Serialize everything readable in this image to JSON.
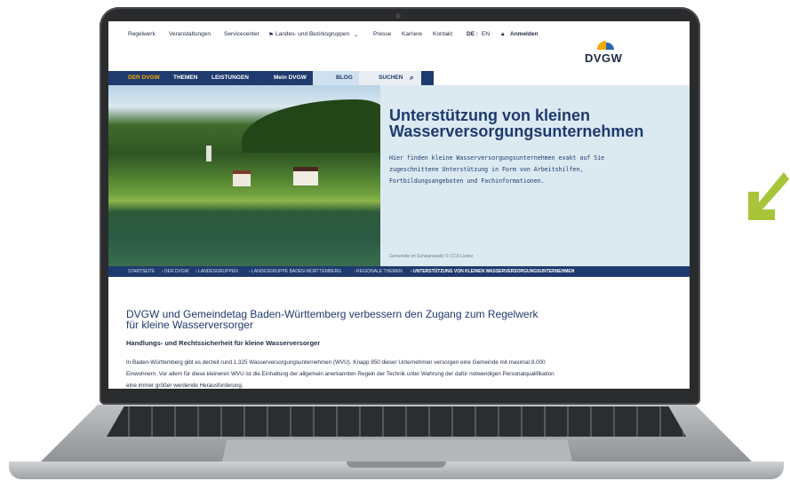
{
  "topnav": {
    "items": [
      "Regelwerk",
      "Veranstaltungen",
      "Servicecenter",
      "Landes- und Bezirksgruppen",
      "Presse",
      "Karriere",
      "Kontakt"
    ],
    "lang_de": "DE",
    "lang_sep": "|",
    "lang_en": "EN",
    "login": "Anmelden"
  },
  "logo": {
    "text": "DVGW"
  },
  "mainnav": {
    "items": [
      "DER DVGW",
      "THEMEN",
      "LEISTUNGEN",
      "Mein DVGW",
      "BLOG",
      "SUCHEN"
    ]
  },
  "hero": {
    "title_line1": "Unterstützung von kleinen",
    "title_line2": "Wasserversorgungsunternehmen",
    "text_line1": "Hier finden kleine Wasserversorgungsunternehmen exakt auf Sie",
    "text_line2": "zugeschnittene Unterstützung in Form von Arbeitshilfen,",
    "text_line3": "Fortbildungsangeboten und Fachinformationen.",
    "caption": "Gemeinde im Schwarzwald; © CC0-Lizenz"
  },
  "breadcrumb": {
    "items": [
      "STARTSEITE",
      "› DER DVGW",
      "› LANDESGRUPPEN",
      "› LANDESGRUPPE BADEN-WÜRTTEMBERG",
      "› REGIONALE THEMEN"
    ],
    "current": "› UNTERSTÜTZUNG VON KLEINEN WASSERVERSORGUNGSUNTERNEHMEN"
  },
  "article": {
    "title_line1": "DVGW und Gemeindetag Baden-Württemberg verbessern den Zugang zum Regelwerk",
    "title_line2": "für kleine Wasserversorger",
    "subtitle": "Handlungs- und Rechtssicherheit für kleine Wasserversorger",
    "body_line1": "In Baden-Württemberg gibt es derzeit rund 1.325 Wasserversorgungsunternehmen (WVU). Knapp 950 dieser Unternehmen versorgen eine Gemeinde mit maximal 8.000",
    "body_line2": "Einwohnern. Vor allem für diese kleineren WVU ist die Einhaltung der allgemein anerkannten Regeln der Technik unter Wahrung der dafür notwendigen Personalqualifikation",
    "body_line3": "eine immer größer werdende Herausforderung."
  },
  "colors": {
    "accent": "#f5a800",
    "brand_blue": "#1f3a6e",
    "arrow_green": "#a8c53a"
  },
  "icons": [
    "flag-icon",
    "chevron-down-icon",
    "lock-icon",
    "search-icon",
    "arrow-down-left-icon"
  ]
}
